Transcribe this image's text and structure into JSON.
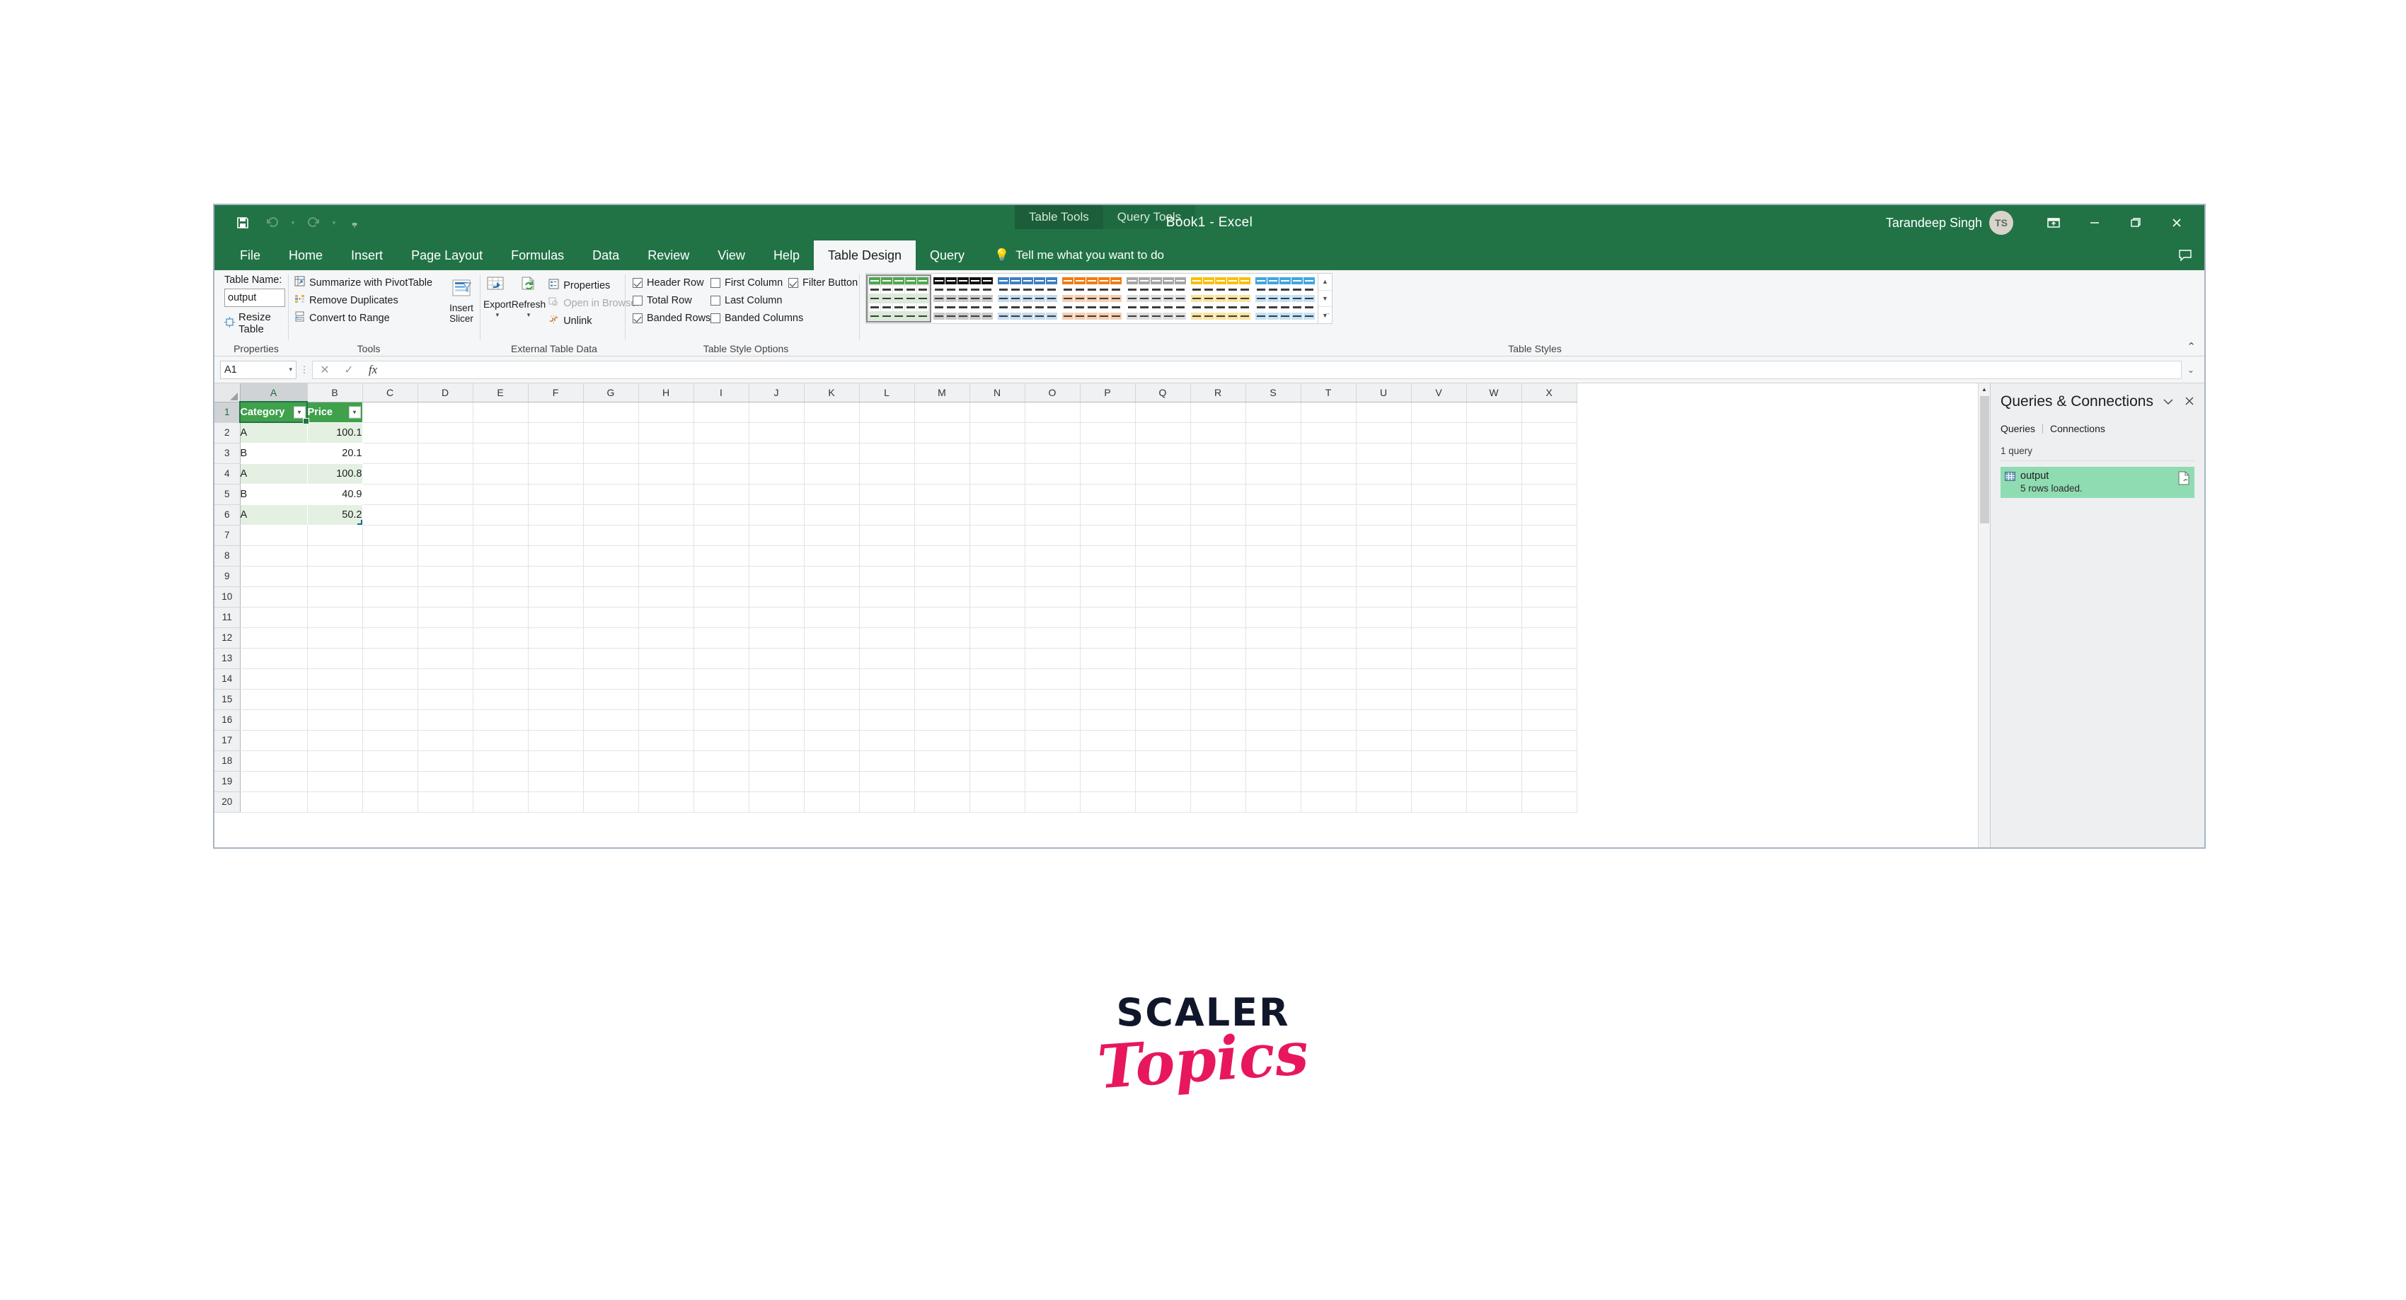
{
  "window": {
    "title": "Book1  -  Excel",
    "account_name": "Tarandeep Singh",
    "avatar_initials": "TS",
    "quick_access": [
      {
        "name": "save",
        "glyph": "save-icon"
      },
      {
        "name": "undo",
        "glyph": "undo-icon"
      },
      {
        "name": "redo",
        "glyph": "redo-icon"
      },
      {
        "name": "customize",
        "glyph": "chevron-down-icon"
      }
    ],
    "controls": {
      "ribbon_display": "ribbon-display-options-icon",
      "minimize": "minimize-icon",
      "restore": "restore-icon",
      "close": "close-icon",
      "comments": "comments-icon"
    }
  },
  "contextual_tabs": [
    {
      "label": "Table Tools"
    },
    {
      "label": "Query Tools"
    }
  ],
  "ribbon_tabs": [
    {
      "label": "File",
      "active": false
    },
    {
      "label": "Home",
      "active": false
    },
    {
      "label": "Insert",
      "active": false
    },
    {
      "label": "Page Layout",
      "active": false
    },
    {
      "label": "Formulas",
      "active": false
    },
    {
      "label": "Data",
      "active": false
    },
    {
      "label": "Review",
      "active": false
    },
    {
      "label": "View",
      "active": false
    },
    {
      "label": "Help",
      "active": false
    },
    {
      "label": "Table Design",
      "active": true
    },
    {
      "label": "Query",
      "active": false
    }
  ],
  "tell_me": "Tell me what you want to do",
  "ribbon": {
    "properties": {
      "group_label": "Properties",
      "table_name_label": "Table Name:",
      "table_name_value": "output",
      "resize_table": "Resize Table"
    },
    "tools": {
      "group_label": "Tools",
      "items": [
        {
          "label": "Summarize with PivotTable",
          "icon": "pivottable-icon"
        },
        {
          "label": "Remove Duplicates",
          "icon": "remove-duplicates-icon"
        },
        {
          "label": "Convert to Range",
          "icon": "convert-to-range-icon"
        }
      ]
    },
    "insert_slicer": {
      "line1": "Insert",
      "line2": "Slicer",
      "icon": "slicer-icon"
    },
    "external_table_data": {
      "group_label": "External Table Data",
      "export": "Export",
      "refresh": "Refresh",
      "items": [
        {
          "label": "Properties",
          "icon": "properties-icon",
          "disabled": false
        },
        {
          "label": "Open in Browser",
          "icon": "open-in-browser-icon",
          "disabled": true
        },
        {
          "label": "Unlink",
          "icon": "unlink-icon",
          "disabled": false
        }
      ]
    },
    "table_style_options": {
      "group_label": "Table Style Options",
      "column1": [
        {
          "label": "Header Row",
          "checked": true
        },
        {
          "label": "Total Row",
          "checked": false
        },
        {
          "label": "Banded Rows",
          "checked": true
        }
      ],
      "column2": [
        {
          "label": "First Column",
          "checked": false
        },
        {
          "label": "Last Column",
          "checked": false
        },
        {
          "label": "Banded Columns",
          "checked": false
        }
      ],
      "column3": [
        {
          "label": "Filter Button",
          "checked": true
        }
      ]
    },
    "table_styles": {
      "group_label": "Table Styles",
      "swatches": [
        {
          "name": "green-style",
          "header": "#4fa74f",
          "band": "#d8ecd5",
          "selected": true
        },
        {
          "name": "black-style",
          "header": "#111111",
          "band": "#c9cacc",
          "selected": false
        },
        {
          "name": "blue-style",
          "header": "#3f7fc1",
          "band": "#c6dbee",
          "selected": false
        },
        {
          "name": "orange-style",
          "header": "#f07c12",
          "band": "#f7cdb0",
          "selected": false
        },
        {
          "name": "grey-style",
          "header": "#a6a6a6",
          "band": "#dedede",
          "selected": false
        },
        {
          "name": "gold-style",
          "header": "#fbbe0a",
          "band": "#fbe3a0",
          "selected": false
        },
        {
          "name": "lightblue-style",
          "header": "#41a6e0",
          "band": "#c3e2f5",
          "selected": false
        }
      ],
      "scroll_controls": [
        "scroll-up-icon",
        "scroll-down-icon",
        "more-styles-icon"
      ]
    },
    "collapse_icon": "collapse-ribbon-icon"
  },
  "formula_bar": {
    "name_box_value": "A1",
    "cancel_icon": "cancel-icon",
    "enter_icon": "enter-icon",
    "function_icon": "insert-function-icon",
    "value": "",
    "expand_icon": "expand-formula-bar-icon"
  },
  "grid": {
    "columns": [
      "A",
      "B",
      "C",
      "D",
      "E",
      "F",
      "G",
      "H",
      "I",
      "J",
      "K",
      "L",
      "M",
      "N",
      "O",
      "P",
      "Q",
      "R",
      "S",
      "T",
      "U",
      "V",
      "W",
      "X"
    ],
    "rows": [
      1,
      2,
      3,
      4,
      5,
      6,
      7,
      8,
      9,
      10,
      11,
      12,
      13,
      14,
      15,
      16,
      17,
      18,
      19,
      20
    ],
    "selected_cell": "A1",
    "table": {
      "headers": [
        "Category",
        "Price"
      ],
      "rows": [
        {
          "Category": "A",
          "Price": "100.1"
        },
        {
          "Category": "B",
          "Price": "20.1"
        },
        {
          "Category": "A",
          "Price": "100.8"
        },
        {
          "Category": "B",
          "Price": "40.9"
        },
        {
          "Category": "A",
          "Price": "50.2"
        }
      ]
    }
  },
  "queries_pane": {
    "title": "Queries & Connections",
    "collapse_icon": "chevron-down-icon",
    "close_icon": "close-icon",
    "tabs": [
      {
        "label": "Queries"
      },
      {
        "label": "Connections"
      }
    ],
    "count_label": "1 query",
    "items": [
      {
        "name": "output",
        "status": "5 rows loaded.",
        "icon": "table-query-icon",
        "preview_icon": "query-preview-icon"
      }
    ]
  },
  "watermark": {
    "line1": "SCALER",
    "line2": "Topics",
    "color1": "#11172b",
    "color2": "#e8175d"
  }
}
